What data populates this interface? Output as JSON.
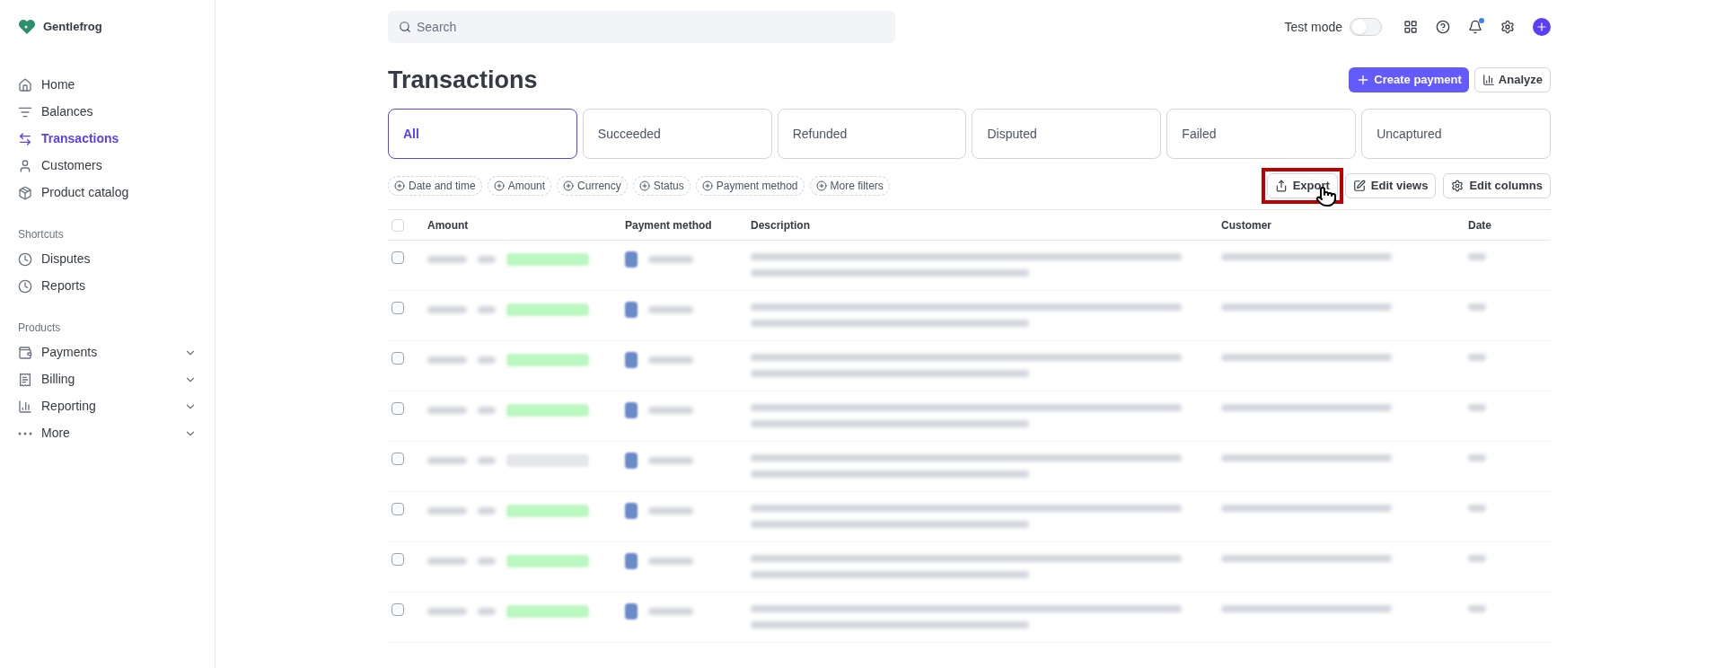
{
  "brand": {
    "name": "Gentlefrog"
  },
  "sidebar": {
    "items": [
      {
        "label": "Home",
        "selected": false
      },
      {
        "label": "Balances",
        "selected": false
      },
      {
        "label": "Transactions",
        "selected": true
      },
      {
        "label": "Customers",
        "selected": false
      },
      {
        "label": "Product catalog",
        "selected": false
      }
    ],
    "sections": [
      {
        "title": "Shortcuts",
        "items": [
          {
            "label": "Disputes",
            "expandable": false
          },
          {
            "label": "Reports",
            "expandable": false
          }
        ]
      },
      {
        "title": "Products",
        "items": [
          {
            "label": "Payments",
            "expandable": true
          },
          {
            "label": "Billing",
            "expandable": true
          },
          {
            "label": "Reporting",
            "expandable": true
          },
          {
            "label": "More",
            "expandable": true
          }
        ]
      }
    ]
  },
  "topbar": {
    "search": {
      "placeholder": "Search"
    },
    "test_mode": {
      "label": "Test mode",
      "on": false
    },
    "notifications_unread": true
  },
  "page": {
    "title": "Transactions",
    "actions": [
      {
        "label": "Create payment",
        "kind": "primary"
      },
      {
        "label": "Analyze",
        "kind": "secondary"
      }
    ]
  },
  "tabs": [
    {
      "label": "All",
      "selected": true
    },
    {
      "label": "Succeeded",
      "selected": false
    },
    {
      "label": "Refunded",
      "selected": false
    },
    {
      "label": "Disputed",
      "selected": false
    },
    {
      "label": "Failed",
      "selected": false
    },
    {
      "label": "Uncaptured",
      "selected": false
    }
  ],
  "filters": [
    "Date and time",
    "Amount",
    "Currency",
    "Status",
    "Payment method",
    "More filters"
  ],
  "toolbar": [
    {
      "label": "Export",
      "highlighted": true
    },
    {
      "label": "Edit views",
      "highlighted": false
    },
    {
      "label": "Edit columns",
      "highlighted": false
    }
  ],
  "table": {
    "select_all_checked": false,
    "columns": [
      "Amount",
      "Payment method",
      "Description",
      "Customer",
      "Date"
    ],
    "rows": [
      {
        "checked": false,
        "color": "#bbf7c0"
      },
      {
        "checked": false,
        "color": "#bbf7c0"
      },
      {
        "checked": false,
        "color": "#bbf7c0"
      },
      {
        "checked": false,
        "color": "#bbf7c0"
      },
      {
        "checked": false,
        "color": "#e5e7eb"
      },
      {
        "checked": false,
        "color": "#bbf7c0"
      },
      {
        "checked": false,
        "color": "#bbf7c0"
      },
      {
        "checked": false,
        "color": "#bbf7c0"
      }
    ]
  }
}
